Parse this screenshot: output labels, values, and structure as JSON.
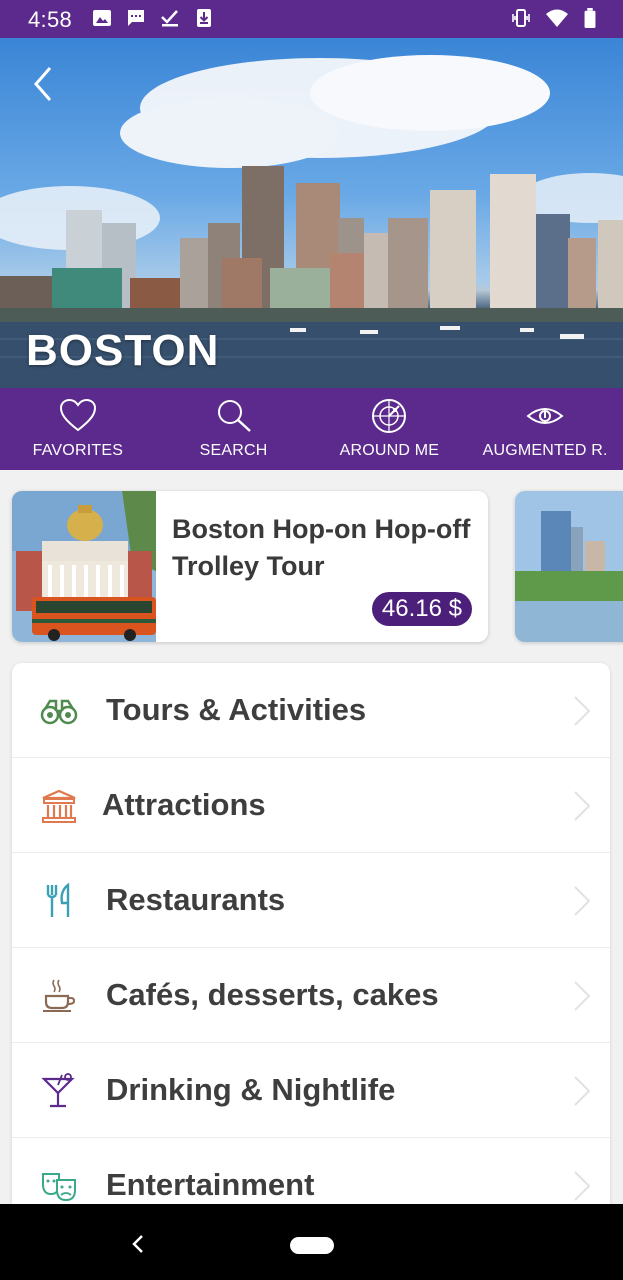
{
  "status_bar": {
    "time": "4:58",
    "left_icons": [
      "image-icon",
      "message-icon",
      "checkmark-download-icon",
      "download-icon"
    ],
    "right_icons": [
      "vibrate-icon",
      "wifi-icon",
      "battery-icon"
    ]
  },
  "hero": {
    "city_name": "BOSTON",
    "back_icon": "chevron-left-icon"
  },
  "nav_tabs": [
    {
      "label": "FAVORITES",
      "icon": "heart-icon"
    },
    {
      "label": "SEARCH",
      "icon": "search-icon"
    },
    {
      "label": "AROUND ME",
      "icon": "radar-icon"
    },
    {
      "label": "AUGMENTED R.",
      "icon": "eye-icon"
    }
  ],
  "promo": {
    "title": "Boston Hop-on Hop-off Trolley Tour",
    "price": "46.16 $"
  },
  "categories": [
    {
      "label": "Tours & Activities",
      "icon": "binoculars-icon",
      "color": "#4f8a4e"
    },
    {
      "label": "Attractions",
      "icon": "museum-icon",
      "color": "#e07a4e"
    },
    {
      "label": "Restaurants",
      "icon": "fork-knife-icon",
      "color": "#3aa0b5"
    },
    {
      "label": "Cafés, desserts, cakes",
      "icon": "coffee-cup-icon",
      "color": "#8a6a55"
    },
    {
      "label": "Drinking & Nightlife",
      "icon": "cocktail-icon",
      "color": "#5b2a8c"
    },
    {
      "label": "Entertainment",
      "icon": "theater-masks-icon",
      "color": "#3aa98a"
    }
  ],
  "colors": {
    "brand_purple": "#5b2a8c",
    "price_badge": "#4b1f7a"
  }
}
